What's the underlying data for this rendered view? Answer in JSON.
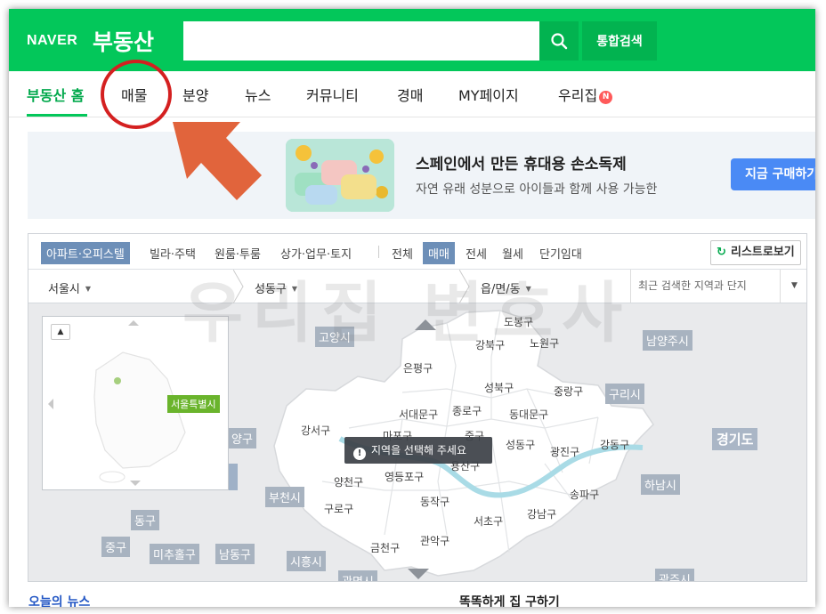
{
  "header": {
    "logo_brand": "NAVER",
    "logo_service": "부동산",
    "search_value": "",
    "search_icon": "search-icon",
    "total_search_label": "통합검색",
    "brand_color": "#03c75a"
  },
  "nav": {
    "items": [
      {
        "label": "부동산 홈",
        "active": true
      },
      {
        "label": "매물"
      },
      {
        "label": "분양"
      },
      {
        "label": "뉴스"
      },
      {
        "label": "커뮤니티"
      },
      {
        "label": "경매"
      },
      {
        "label": "MY페이지"
      },
      {
        "label": "우리집"
      }
    ],
    "new_badge": "N"
  },
  "annotation": {
    "circle_color": "#d42020",
    "arrow_color": "#e1643c"
  },
  "ad": {
    "title": "스페인에서 만든 휴대용 손소독제",
    "description": "자연 유래 성분으로 아이들과 함께 사용 가능한",
    "button_label": "지금 구매하기"
  },
  "filters": {
    "property_types": [
      {
        "label": "아파트·오피스텔",
        "selected": true
      },
      {
        "label": "빌라·주택"
      },
      {
        "label": "원룸·투룸"
      },
      {
        "label": "상가·업무·토지"
      }
    ],
    "deal_types": [
      {
        "label": "전체"
      },
      {
        "label": "매매",
        "selected": true
      },
      {
        "label": "전세"
      },
      {
        "label": "월세"
      },
      {
        "label": "단기임대"
      }
    ],
    "list_view_label": "리스트로보기"
  },
  "location": {
    "city": "서울시",
    "district": "성동구",
    "neighborhood": "읍/면/동",
    "search_placeholder": "최근 검색한 지역과 단지"
  },
  "map": {
    "minimap_label": "서울특별시",
    "tooltip": "지역을 선택해 주세요",
    "districts": {
      "dobong": "도봉구",
      "nowon": "노원구",
      "gangbuk": "강북구",
      "eunpyeong": "은평구",
      "seongbuk": "성북구",
      "jungnang": "중랑구",
      "jongno": "종로구",
      "seodaemun": "서대문구",
      "dongdaemun": "동대문구",
      "gangseo": "강서구",
      "mapo": "마포구",
      "jung": "중구",
      "seongdong": "성동구",
      "gwangjin": "광진구",
      "gangdong": "강동구",
      "yongsan": "용산구",
      "yeongdeungpo": "영등포구",
      "yangcheon": "양천구",
      "songpa": "송파구",
      "guro": "구로구",
      "dongjak": "동작구",
      "seocho": "서초구",
      "gangnam": "강남구",
      "gwanak": "관악구",
      "geumcheon": "금천구"
    },
    "outside": {
      "goyang": "고양시",
      "namyangju": "남양주시",
      "guri": "구리시",
      "gyeonggi": "경기도",
      "hanam": "하남시",
      "gwangju": "광주시",
      "bucheon": "부천시",
      "gimpo_edge": "양구",
      "dong_gu": "동구",
      "jung_gu": "중구",
      "michuhol": "미추홀구",
      "namdong": "남동구",
      "siheung": "시흥시",
      "gwangmyeong": "광명시"
    }
  },
  "watermark": "우리집 변호사",
  "bottom": {
    "news_heading": "오늘의 뉴스",
    "right_heading": "똑똑하게 집 구하기"
  }
}
